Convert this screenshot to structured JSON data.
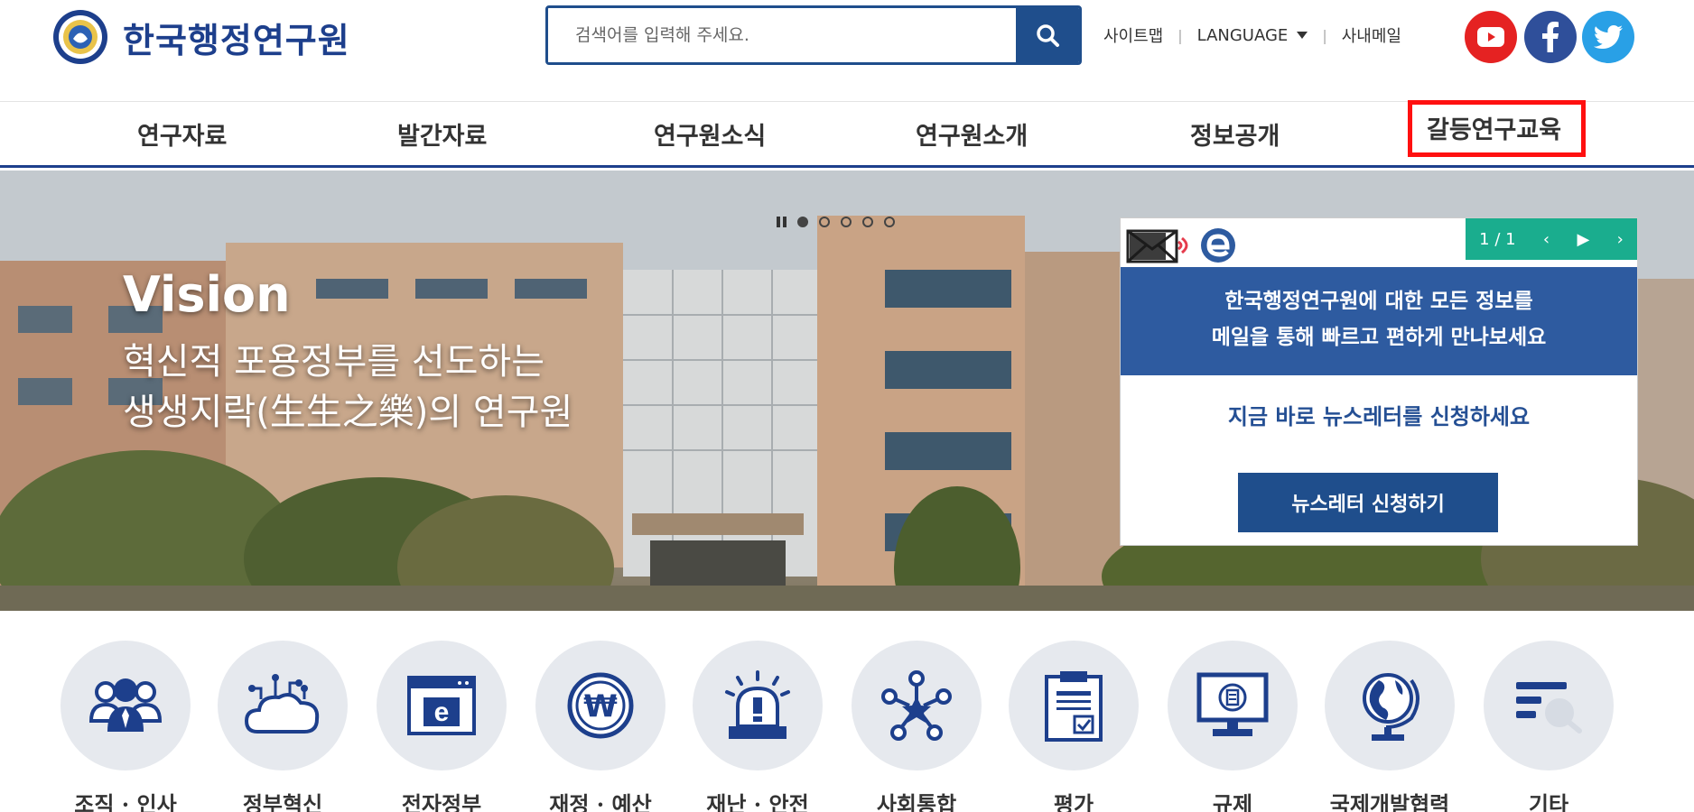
{
  "header": {
    "logo_text": "한국행정연구원",
    "search_placeholder": "검색어를 입력해 주세요.",
    "util": {
      "sitemap": "사이트맵",
      "language": "LANGUAGE",
      "mail": "사내메일"
    },
    "sns": [
      "youtube-icon",
      "facebook-icon",
      "twitter-icon"
    ]
  },
  "gnb": {
    "items": [
      "연구자료",
      "발간자료",
      "연구원소식",
      "연구원소개",
      "정보공개",
      "갈등연구교육"
    ],
    "active_index": 5,
    "highlight_color": "#ff1010"
  },
  "hero": {
    "title": "Vision",
    "subtitle": "혁신적 포용정부를 선도하는\n생생지락(生生之樂)의 연구원",
    "slide_count": 5,
    "current_slide": 1
  },
  "newsletter": {
    "pager": "1 / 1",
    "band_text": "한국행정연구원에 대한 모든 정보를\n메일을 통해 빠르고 편하게 만나보세요",
    "cta_text": "지금 바로 뉴스레터를 신청하세요",
    "button": "뉴스레터 신청하기"
  },
  "categories": [
    {
      "label": "조직 · 인사",
      "icon": "people-icon"
    },
    {
      "label": "정부혁신",
      "icon": "cloud-network-icon"
    },
    {
      "label": "전자정부",
      "icon": "browser-e-icon"
    },
    {
      "label": "재정 · 예산",
      "icon": "won-coin-icon"
    },
    {
      "label": "재난 · 안전",
      "icon": "alarm-icon"
    },
    {
      "label": "사회통합",
      "icon": "star-network-icon"
    },
    {
      "label": "평가",
      "icon": "clipboard-check-icon"
    },
    {
      "label": "규제",
      "icon": "monitor-icon"
    },
    {
      "label": "국제개발협력",
      "icon": "globe-icon"
    },
    {
      "label": "기타",
      "icon": "list-search-icon"
    }
  ],
  "colors": {
    "brand": "#1d3f8c",
    "newsletter_band": "#2e5ba0",
    "pager": "#1aad8e"
  }
}
